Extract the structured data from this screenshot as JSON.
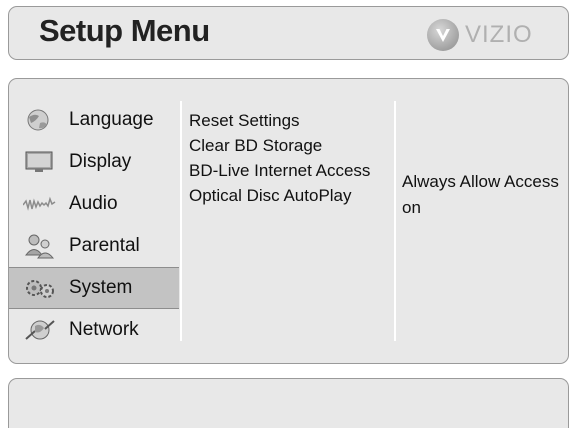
{
  "header": {
    "title": "Setup Menu",
    "brand": "VIZIO"
  },
  "menu": {
    "items": [
      {
        "label": "Language",
        "icon": "globe-icon"
      },
      {
        "label": "Display",
        "icon": "monitor-icon"
      },
      {
        "label": "Audio",
        "icon": "audio-wave-icon"
      },
      {
        "label": "Parental",
        "icon": "parental-users-icon"
      },
      {
        "label": "System",
        "icon": "gears-icon",
        "selected": true
      },
      {
        "label": "Network",
        "icon": "network-globe-icon"
      }
    ]
  },
  "submenu": {
    "items": [
      "Reset Settings",
      "Clear BD Storage",
      "BD-Live Internet Access",
      "Optical Disc AutoPlay"
    ]
  },
  "values": {
    "items": [
      "Always Allow Access",
      "on"
    ]
  },
  "colors": {
    "panel": "#e8e8e8",
    "selected": "#c3c3c3",
    "border": "#9a9a9a"
  }
}
